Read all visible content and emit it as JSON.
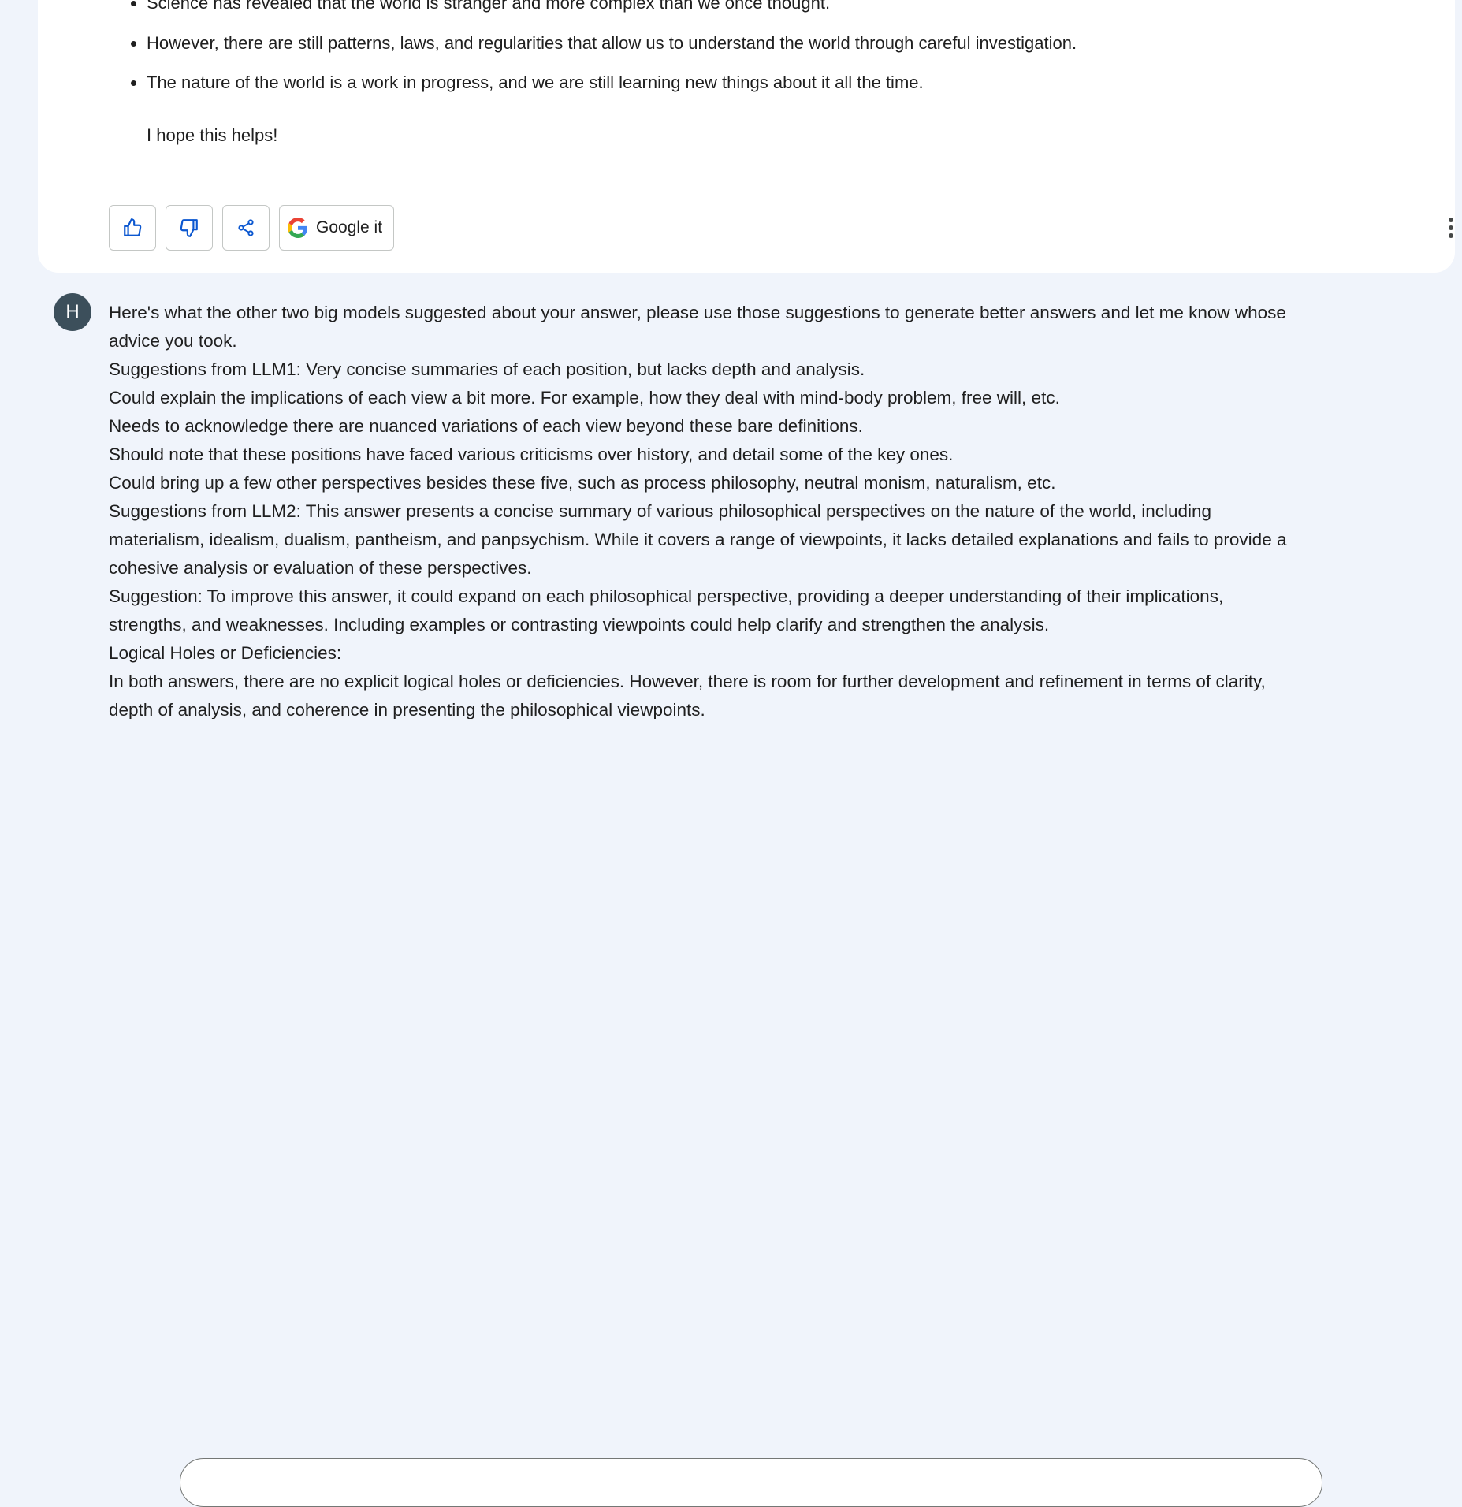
{
  "response": {
    "bullets": [
      "Science has revealed that the world is stranger and more complex than we once thought.",
      "However, there are still patterns, laws, and regularities that allow us to understand the world through careful investigation.",
      "The nature of the world is a work in progress, and we are still learning new things about it all the time."
    ],
    "closing": "I hope this helps!",
    "actions": {
      "thumbs_up_icon": "thumb-up-icon",
      "thumbs_down_icon": "thumb-down-icon",
      "share_icon": "share-icon",
      "google_label": "Google it",
      "more_icon": "more-vert-icon"
    }
  },
  "user_message": {
    "avatar_initial": "H",
    "lines": [
      "Here's what the other two big models suggested about your answer, please use those suggestions to generate better answers and let me know whose",
      "advice you took.",
      "Suggestions from LLM1: Very concise summaries of each position, but lacks depth and analysis.",
      "Could explain the implications of each view a bit more. For example, how they deal with mind-body problem, free will, etc.",
      "Needs to acknowledge there are nuanced variations of each view beyond these bare definitions.",
      "Should note that these positions have faced various criticisms over history, and detail some of the key ones.",
      "Could bring up a few other perspectives besides these five, such as process philosophy, neutral monism, naturalism, etc.",
      "Suggestions from LLM2: This answer presents a concise summary of various philosophical perspectives on the nature of the world, including",
      "materialism, idealism, dualism, pantheism, and panpsychism. While it covers a range of viewpoints, it lacks detailed explanations and fails to provide a",
      "cohesive analysis or evaluation of these perspectives.",
      "Suggestion: To improve this answer, it could expand on each philosophical perspective, providing a deeper understanding of their implications,",
      "strengths, and weaknesses. Including examples or contrasting viewpoints could help clarify and strengthen the analysis.",
      "Logical Holes or Deficiencies:",
      "In both answers, there are no explicit logical holes or deficiencies. However, there is room for further development and refinement in terms of clarity,",
      "depth of analysis, and coherence in presenting the philosophical viewpoints."
    ]
  },
  "colors": {
    "page_bg": "#f0f4fb",
    "card_bg": "#ffffff",
    "icon_blue": "#0b57d0",
    "avatar_bg": "#3c4f5b"
  }
}
